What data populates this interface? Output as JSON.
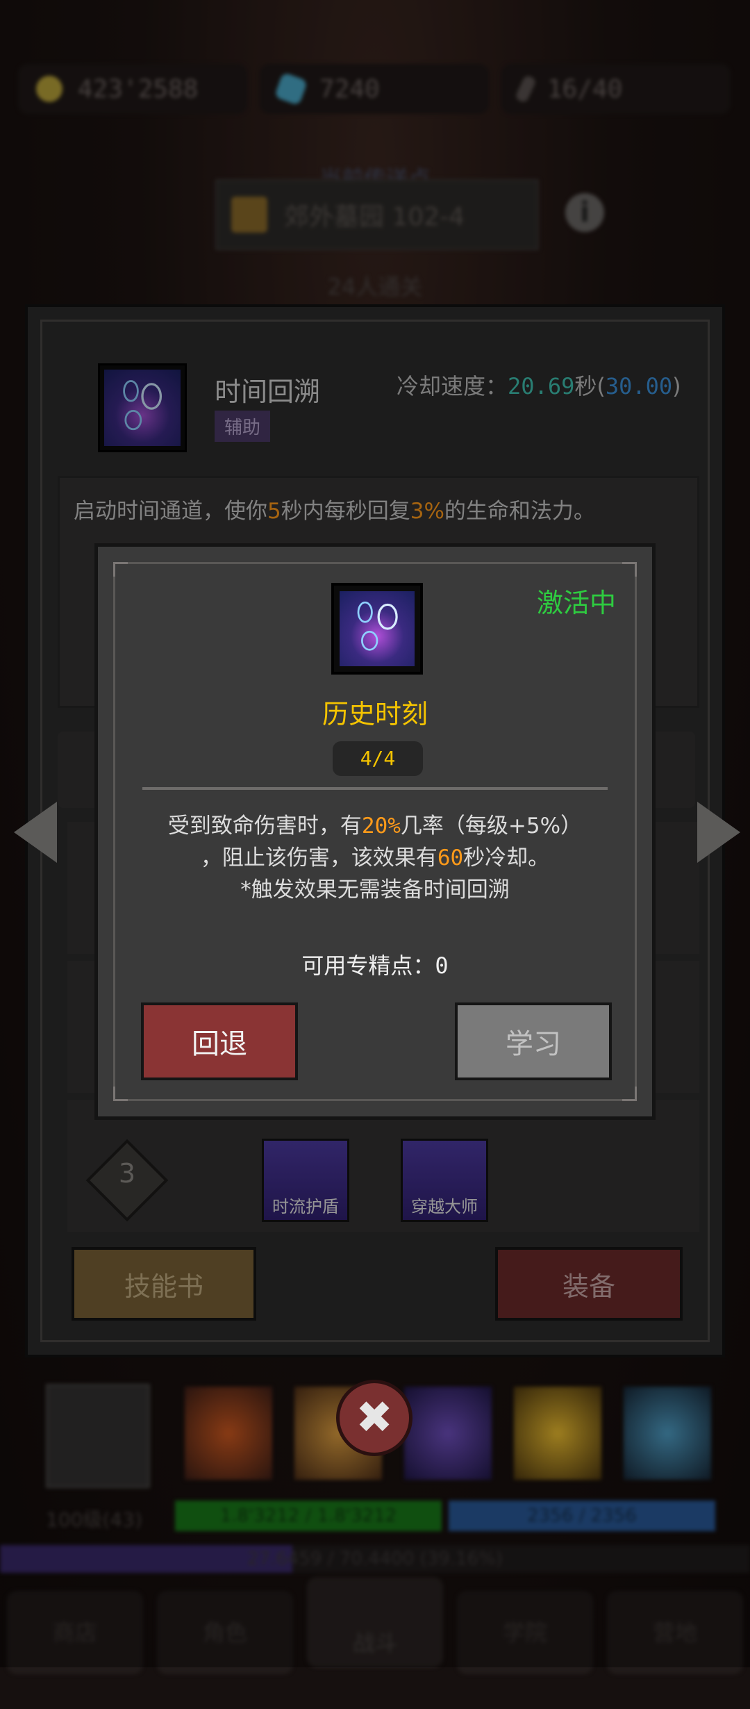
{
  "resources": [
    {
      "icon": "gold-coin-icon",
      "value": "423'2588"
    },
    {
      "icon": "blue-gem-icon",
      "value": "7240"
    },
    {
      "icon": "feather-icon",
      "value": "16/40"
    }
  ],
  "teleport": {
    "title": "当前传送点",
    "location": "郊外墓园 102-4",
    "cleared": "24人通关"
  },
  "skill": {
    "name": "时间回溯",
    "tag": "辅助",
    "cooldown_label": "冷却速度：",
    "cooldown_current": "20.69",
    "cooldown_unit": "秒(",
    "cooldown_base": "30.00",
    "cooldown_close": ")",
    "desc_part1": "启动时间通道，使你",
    "desc_num1": "5",
    "desc_part2": "秒内每秒回复",
    "desc_num2": "3%",
    "desc_part3": "的生命和法力。"
  },
  "talent_row": {
    "level": "3",
    "node_a": "时流护盾",
    "node_b": "穿越大师"
  },
  "panel_buttons": {
    "skillbook": "技能书",
    "equip": "装备"
  },
  "modal": {
    "status": "激活中",
    "title": "历史时刻",
    "level": "4/4",
    "line1_a": "受到致命伤害时，有",
    "line1_num": "20%",
    "line1_b": "几率（每级+5%）",
    "line2_a": "，阻止该伤害，该效果有",
    "line2_num": "60",
    "line2_b": "秒冷却。",
    "line3": "*触发效果无需装备时间回溯",
    "points_label": "可用专精点：",
    "points_value": "0",
    "btn_back": "回退",
    "btn_learn": "学习"
  },
  "bottom": {
    "level_text": "100级(43)",
    "hp_text": "1.8'3212 / 1.8'3212",
    "mp_text": "2356 / 2356",
    "exp_text": "27.6459 / 70.4400 (39.16%)",
    "nav": [
      "商店",
      "角色",
      "战斗",
      "学院",
      "营地"
    ]
  },
  "colors": {
    "accent_orange": "#ff9a1a",
    "accent_green": "#2ecc40",
    "title_yellow": "#f5c400",
    "cd_teal": "#3fc1b0",
    "cd_blue": "#3b8fd8",
    "btn_red": "#8a3434",
    "btn_gray": "#7a7a7a",
    "btn_gold": "#7a6236"
  }
}
